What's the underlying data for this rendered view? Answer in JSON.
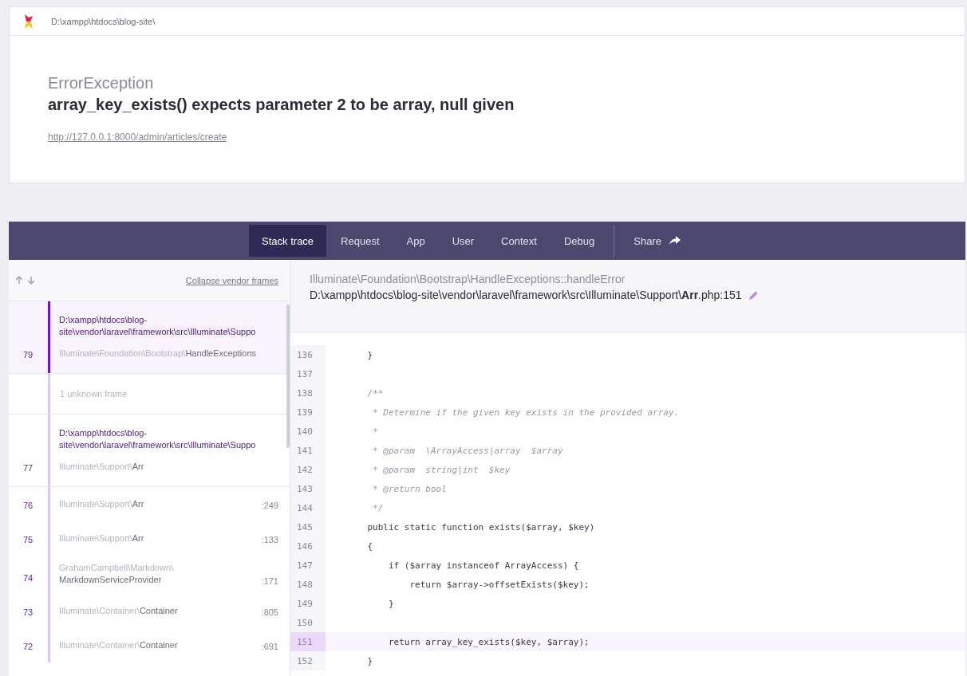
{
  "header": {
    "path": "D:\\xampp\\htdocs\\blog-site\\"
  },
  "error": {
    "class": "ErrorException",
    "message": "array_key_exists() expects parameter 2 to be array, null given",
    "url": "http://127.0.0.1:8000/admin/articles/create"
  },
  "tabs": [
    {
      "label": "Stack trace",
      "selected": true,
      "kind": "tab"
    },
    {
      "label": "Request",
      "selected": false,
      "kind": "tab"
    },
    {
      "label": "App",
      "selected": false,
      "kind": "tab"
    },
    {
      "label": "User",
      "selected": false,
      "kind": "tab"
    },
    {
      "label": "Context",
      "selected": false,
      "kind": "tab"
    },
    {
      "label": "Debug",
      "selected": false,
      "kind": "tab"
    },
    {
      "label": "Share",
      "selected": false,
      "kind": "share"
    }
  ],
  "stack": {
    "collapse_link": "Collapse vendor frames",
    "frames": [
      {
        "kind": "frame",
        "number": "79",
        "file": "D:\\xampp\\htdocs\\blog-site\\vendor\\laravel\\framework\\src\\Illuminate\\Suppo",
        "namespace": "Illuminate\\Foundation\\Bootstrap\\",
        "class": "HandleExceptions",
        "selected": true
      },
      {
        "kind": "unknown",
        "label": "1 unknown frame"
      },
      {
        "kind": "frame",
        "number": "77",
        "file": "D:\\xampp\\htdocs\\blog-site\\vendor\\laravel\\framework\\src\\Illuminate\\Suppo",
        "namespace": "Illuminate\\Support\\",
        "class": "Arr",
        "selected": false
      },
      {
        "kind": "frame",
        "number": "76",
        "namespace": "Illuminate\\Support\\",
        "class": "Arr",
        "line": ":249",
        "selected": false
      },
      {
        "kind": "frame",
        "number": "75",
        "namespace": "Illuminate\\Support\\",
        "class": "Arr",
        "line": ":133",
        "selected": false
      },
      {
        "kind": "frame",
        "number": "74",
        "namespace": "GrahamCampbell\\Markdown\\",
        "class": "MarkdownServiceProvider",
        "line": ":171",
        "selected": false,
        "wrap": true
      },
      {
        "kind": "frame",
        "number": "73",
        "namespace": "Illuminate\\Container\\",
        "class": "Container",
        "line": ":805",
        "selected": false
      },
      {
        "kind": "frame",
        "number": "72",
        "namespace": "Illuminate\\Container\\",
        "class": "Container",
        "line": ":691",
        "selected": false
      }
    ]
  },
  "code": {
    "method": "Illuminate\\Foundation\\Bootstrap\\HandleExceptions::handleError",
    "file": "D:\\xampp\\htdocs\\blog-site\\vendor\\laravel\\framework\\src\\Illuminate\\Support\\**Arr**.php:151",
    "lines": [
      {
        "number": "136",
        "text": "    }",
        "kind": "code",
        "selected": false
      },
      {
        "number": "137",
        "selected": false
      },
      {
        "number": "138",
        "text": "    /**",
        "kind": "comment",
        "selected": false
      },
      {
        "number": "139",
        "text": "     * Determine if the given key exists in the provided array.",
        "kind": "comment",
        "selected": false
      },
      {
        "number": "140",
        "text": "     *",
        "kind": "comment",
        "selected": false
      },
      {
        "number": "141",
        "text": "     * @param  \\ArrayAccess|array  $array",
        "kind": "comment",
        "selected": false
      },
      {
        "number": "142",
        "text": "     * @param  string|int  $key",
        "kind": "comment",
        "selected": false
      },
      {
        "number": "143",
        "text": "     * @return bool",
        "kind": "comment",
        "selected": false
      },
      {
        "number": "144",
        "text": "     */",
        "kind": "comment",
        "selected": false
      },
      {
        "number": "145",
        "text": "    public static function exists($array, $key)",
        "kind": "code",
        "selected": false
      },
      {
        "number": "146",
        "text": "    {",
        "kind": "code",
        "selected": false
      },
      {
        "number": "147",
        "text": "        if ($array instanceof ArrayAccess) {",
        "kind": "code",
        "selected": false
      },
      {
        "number": "148",
        "text": "            return $array->offsetExists($key);",
        "kind": "code",
        "selected": false
      },
      {
        "number": "149",
        "text": "        }",
        "kind": "code",
        "selected": false
      },
      {
        "number": "150",
        "selected": false
      },
      {
        "number": "151",
        "text": "        return array_key_exists($key, $array);",
        "kind": "code",
        "selected": true
      },
      {
        "number": "152",
        "text": "    }",
        "kind": "code",
        "selected": false
      }
    ]
  }
}
